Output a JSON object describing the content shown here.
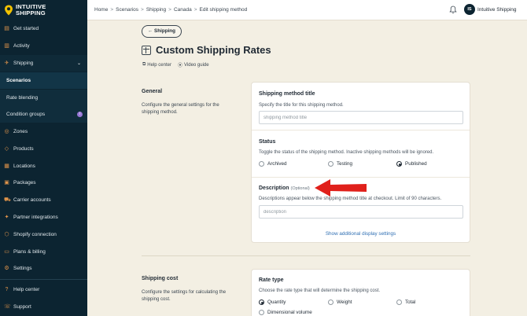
{
  "brand": {
    "line1": "INTUITIVE",
    "line2": "SHIPPING"
  },
  "sidebar": {
    "items": [
      {
        "label": "Get started",
        "icon": "clipboard-icon"
      },
      {
        "label": "Activity",
        "icon": "activity-icon"
      },
      {
        "label": "Shipping",
        "icon": "shipping-icon"
      },
      {
        "label": "Scenarios"
      },
      {
        "label": "Rate blending"
      },
      {
        "label": "Condition groups",
        "badge": "i"
      },
      {
        "label": "Zones",
        "icon": "globe-icon"
      },
      {
        "label": "Products",
        "icon": "tag-icon"
      },
      {
        "label": "Locations",
        "icon": "building-icon"
      },
      {
        "label": "Packages",
        "icon": "box-icon"
      },
      {
        "label": "Carrier accounts",
        "icon": "truck-icon"
      },
      {
        "label": "Partner integrations",
        "icon": "integration-icon"
      },
      {
        "label": "Shopify connection",
        "icon": "shopify-icon"
      },
      {
        "label": "Plans & billing",
        "icon": "card-icon"
      },
      {
        "label": "Settings",
        "icon": "gear-icon"
      },
      {
        "label": "Help center",
        "icon": "help-icon"
      },
      {
        "label": "Support",
        "icon": "support-icon"
      }
    ]
  },
  "breadcrumb": [
    "Home",
    "Scenarios",
    "Shipping",
    "Canada",
    "Edit shipping method"
  ],
  "user": {
    "initials": "IS",
    "name": "Intuitive Shipping"
  },
  "back_button": "Shipping",
  "page_title": "Custom Shipping Rates",
  "help_links": {
    "help_center": "Help center",
    "video_guide": "Video guide"
  },
  "general": {
    "title": "General",
    "description": "Configure the general settings for the shipping method.",
    "method_title": {
      "label": "Shipping method title",
      "description": "Specify the title for this shipping method.",
      "placeholder": "shipping method title"
    },
    "status": {
      "label": "Status",
      "description": "Toggle the status of the shipping method. Inactive shipping methods will be ignored.",
      "options": [
        "Archived",
        "Testing",
        "Published"
      ],
      "selected": "Published"
    },
    "description_field": {
      "label": "Description",
      "optional": "(Optional)",
      "description": "Descriptions appear below the shipping method title at checkout. Limit of 90 characters.",
      "placeholder": "description"
    },
    "show_more": "Show additional display settings"
  },
  "shipping_cost": {
    "title": "Shipping cost",
    "description": "Configure the settings for calculating the shipping cost.",
    "rate_type": {
      "label": "Rate type",
      "description": "Choose the rate type that will determine the shipping cost.",
      "options": [
        "Quantity",
        "Weight",
        "Total",
        "Dimensional volume"
      ],
      "selected": "Quantity"
    }
  },
  "colors": {
    "sidebar": "#0c2431",
    "accent_orange": "#e2954b",
    "arrow_red": "#e0201b",
    "link_blue": "#2f6fb3"
  }
}
